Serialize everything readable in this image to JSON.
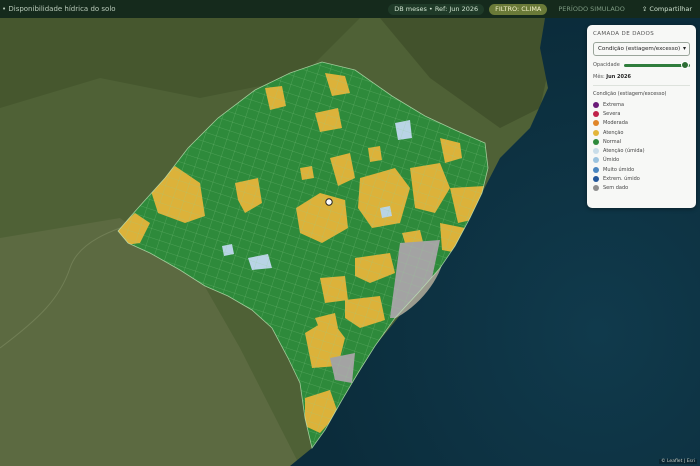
{
  "header": {
    "title": "• Disponibilidade hídrica do solo",
    "meta": "DB meses • Ref: Jun 2026",
    "filter": "FILTRO: CLIMA",
    "period": "PERÍODO SIMULADO",
    "share": "Compartilhar"
  },
  "panel": {
    "heading": "CAMADA DE DADOS",
    "select_value": "Condição (estiagem/excesso)",
    "opacity_label": "Opacidade",
    "opacity": 0.92,
    "month_label": "Mês:",
    "month_value": "Jun 2026",
    "legend_title": "Condição (estiagem/excesso)",
    "legend": [
      {
        "label": "Extrema",
        "color": "#6b1b78"
      },
      {
        "label": "Severa",
        "color": "#c0224a"
      },
      {
        "label": "Moderada",
        "color": "#e0862a"
      },
      {
        "label": "Atenção",
        "color": "#e3b53a"
      },
      {
        "label": "Normal",
        "color": "#2e8a3b"
      },
      {
        "label": "Atenção (úmida)",
        "color": "#c9dde9"
      },
      {
        "label": "Úmido",
        "color": "#9bc3df"
      },
      {
        "label": "Muito úmido",
        "color": "#4a86c0"
      },
      {
        "label": "Extrem. úmido",
        "color": "#23579a"
      },
      {
        "label": "Sem dado",
        "color": "#8d8d8d"
      }
    ]
  },
  "map": {
    "colors": {
      "normal": "#2e8a3b",
      "attention": "#dcb23a",
      "nodata": "#a3a3a3",
      "humid": "#b9d4e6",
      "ocean": "#0f4153",
      "land": "#4e5f35"
    }
  },
  "attribution": "© Leaflet | Esri"
}
